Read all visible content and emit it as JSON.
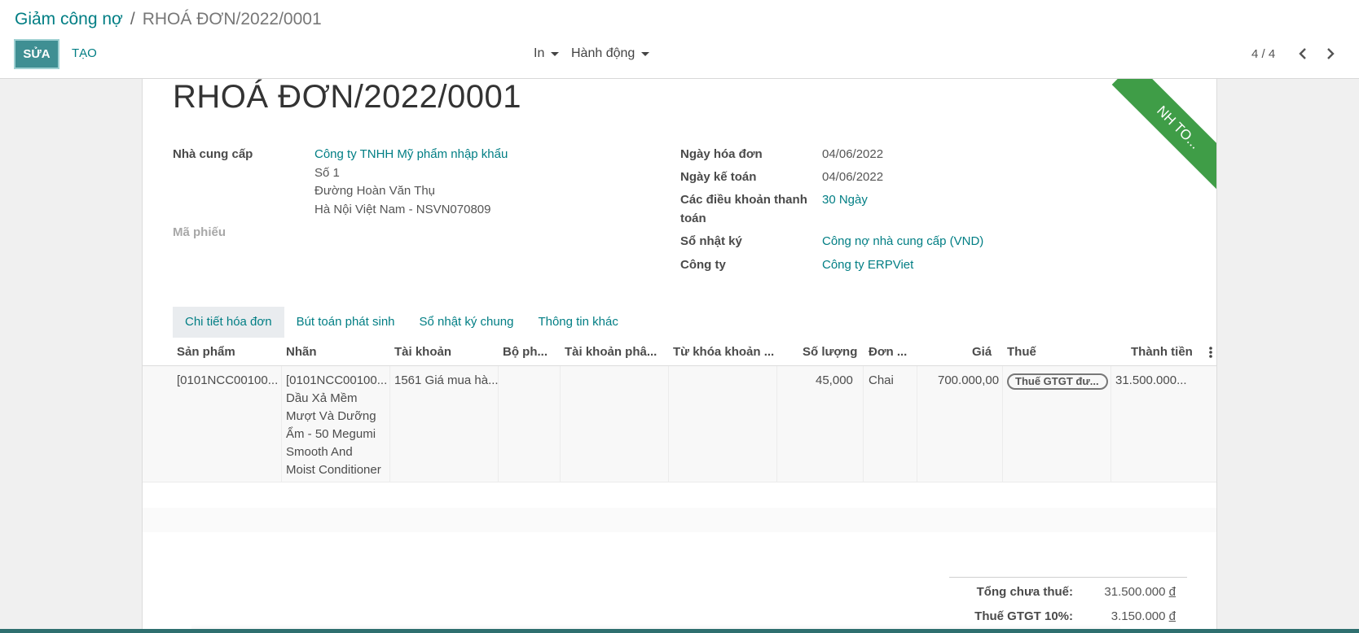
{
  "breadcrumb": {
    "parent": "Giảm công nợ",
    "separator": "/",
    "current": "RHOÁ ĐƠN/2022/0001"
  },
  "toolbar": {
    "edit_label": "SỬA",
    "create_label": "TẠO",
    "print_label": "In",
    "action_label": "Hành động"
  },
  "pager": {
    "text": "4 / 4"
  },
  "document": {
    "title": "RHOÁ ĐƠN/2022/0001",
    "ribbon_text": "NH TO...",
    "ribbon_color": "#3f9d47",
    "vendor_label": "Nhà cung cấp",
    "vendor_name": "Công ty TNHH Mỹ phẩm nhập khẩu",
    "vendor_addr1": "Số 1",
    "vendor_addr2": "Đường Hoàn Văn Thụ",
    "vendor_addr3": "Hà Nội Việt Nam - NSVN070809",
    "ref_label": "Mã phiếu",
    "invoice_date_label": "Ngày hóa đơn",
    "invoice_date": "04/06/2022",
    "accounting_date_label": "Ngày kế toán",
    "accounting_date": "04/06/2022",
    "payment_terms_label_1": "Các điều khoản thanh",
    "payment_terms_label_2": "toán",
    "payment_terms": "30 Ngày",
    "journal_label": "Sổ nhật ký",
    "journal": "Công nợ nhà cung cấp (VND)",
    "company_label": "Công ty",
    "company": "Công ty ERPViet"
  },
  "tabs": [
    {
      "label": "Chi tiết hóa đơn"
    },
    {
      "label": "Bút toán phát sinh"
    },
    {
      "label": "Sổ nhật ký chung"
    },
    {
      "label": "Thông tin khác"
    }
  ],
  "table": {
    "headers": {
      "product": "Sản phẩm",
      "label": "Nhãn",
      "account": "Tài khoản",
      "department": "Bộ ph...",
      "analytic": "Tài khoản phâ...",
      "keyword": "Từ khóa khoản ...",
      "qty": "Số lượng",
      "uom": "Đơn ...",
      "price": "Giá",
      "tax": "Thuế",
      "subtotal": "Thành tiền"
    },
    "rows": [
      {
        "product": "[0101NCC00100...",
        "label_1": "[0101NCC00100...",
        "label_2": "Dầu Xả Mềm",
        "label_3": "Mượt Và Dưỡng",
        "label_4": "Ẩm - 50 Megumi",
        "label_5": "Smooth And",
        "label_6": "Moist Conditioner",
        "account": "1561 Giá mua hà...",
        "qty": "45,000",
        "uom": "Chai",
        "price": "700.000,00",
        "tax": "Thuế GTGT đư...",
        "subtotal": "31.500.000..."
      }
    ]
  },
  "totals": {
    "untaxed_label": "Tổng chưa thuế:",
    "untaxed_amount": "31.500.000",
    "vat_label": "Thuế GTGT 10%:",
    "vat_amount": "3.150.000",
    "currency_symbol": "đ"
  },
  "colors": {
    "accent": "#017e84",
    "edit_button": "#3f8f93"
  }
}
